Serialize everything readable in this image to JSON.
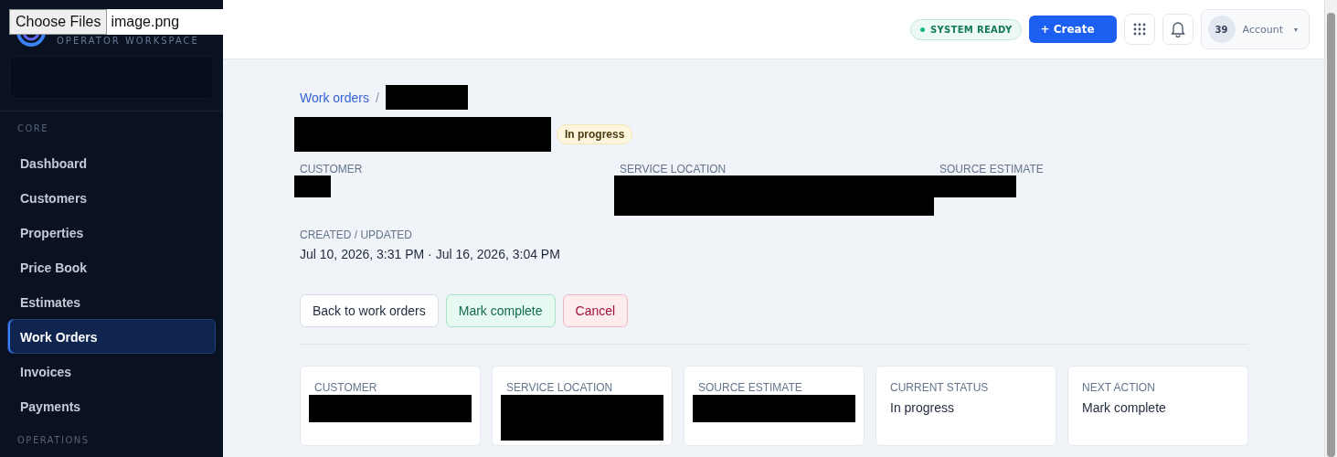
{
  "file_picker": {
    "button": "Choose Files",
    "filename": "image.png"
  },
  "sidebar": {
    "subtitle": "OPERATOR WORKSPACE",
    "sections": [
      {
        "title": "CORE",
        "items": [
          {
            "label": "Dashboard",
            "selected": false
          },
          {
            "label": "Customers",
            "selected": false
          },
          {
            "label": "Properties",
            "selected": false
          },
          {
            "label": "Price Book",
            "selected": false
          },
          {
            "label": "Estimates",
            "selected": false
          },
          {
            "label": "Work Orders",
            "selected": true
          },
          {
            "label": "Invoices",
            "selected": false
          },
          {
            "label": "Payments",
            "selected": false
          }
        ]
      },
      {
        "title": "OPERATIONS"
      }
    ]
  },
  "topbar": {
    "status": "SYSTEM READY",
    "create": "+ Create",
    "account": {
      "badge": "39",
      "label": "Account",
      "caret": "▾"
    }
  },
  "breadcrumb": {
    "link": "Work orders",
    "separator": "/",
    "current_redacted": true
  },
  "header": {
    "title_redacted": true,
    "badge": "In progress"
  },
  "details": [
    {
      "label": "CUSTOMER",
      "redacted": true
    },
    {
      "label": "SERVICE LOCATION",
      "redacted": true
    },
    {
      "label": "SOURCE ESTIMATE",
      "redacted": true
    }
  ],
  "created_updated": {
    "label": "CREATED / UPDATED",
    "value": "Jul 10, 2026, 3:31 PM · Jul 16, 2026, 3:04 PM"
  },
  "actions": [
    {
      "label": "Back to work orders",
      "kind": "default"
    },
    {
      "label": "Mark complete",
      "kind": "success"
    },
    {
      "label": "Cancel",
      "kind": "danger"
    }
  ],
  "cards": [
    {
      "label": "CUSTOMER",
      "redacted": true
    },
    {
      "label": "SERVICE LOCATION",
      "redacted": true
    },
    {
      "label": "SOURCE ESTIMATE",
      "redacted": true
    },
    {
      "label": "CURRENT STATUS",
      "value": "In progress"
    },
    {
      "label": "NEXT ACTION",
      "value": "Mark complete"
    }
  ]
}
